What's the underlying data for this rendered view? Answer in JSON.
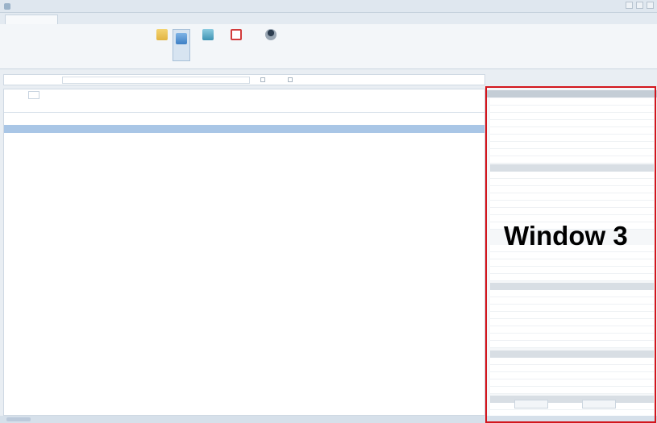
{
  "window": {
    "title": "",
    "controls": [
      "minimize-icon",
      "maximize-icon",
      "close-icon"
    ]
  },
  "ribbon_tabs": [
    {
      "label": "",
      "active": true
    },
    {
      "label": "",
      "active": false
    }
  ],
  "help_link": "",
  "ribbon": {
    "status_block": {
      "labels": [
        "",
        "",
        "",
        ""
      ],
      "values": [
        "",
        "",
        "",
        ""
      ]
    },
    "info_block": {
      "labels": [
        "",
        "",
        ""
      ],
      "values": [
        "",
        "",
        ""
      ]
    },
    "buttons": [
      {
        "label": "",
        "icon": "zoom-icon",
        "pressed": false
      },
      {
        "label": "",
        "icon": "device-icon",
        "pressed": true
      },
      {
        "label": "",
        "icon": "monitor-icon",
        "pressed": false
      },
      {
        "label": "",
        "icon": "stop-record-icon",
        "pressed": false
      },
      {
        "label": "",
        "icon": "user-icon",
        "pressed": false
      }
    ],
    "footer_labels": [
      "",
      ""
    ]
  },
  "filter": {
    "label": "",
    "input_value": "",
    "checks": [
      "",
      ""
    ]
  },
  "grid": {
    "group_label": "",
    "group_value": "",
    "columns": [
      "",
      "",
      "",
      "",
      "",
      "",
      ""
    ],
    "group_header": "",
    "rows": [
      {
        "cells": [
          "",
          "",
          "",
          "",
          "",
          "",
          ""
        ]
      }
    ]
  },
  "properties": {
    "title": "",
    "sections": [
      {
        "label": "",
        "rows": [
          {
            "k": "",
            "v": ""
          }
        ]
      }
    ],
    "buttons": [
      "",
      ""
    ]
  },
  "annotation": {
    "label": "Window 3",
    "color": "#d3161d"
  }
}
